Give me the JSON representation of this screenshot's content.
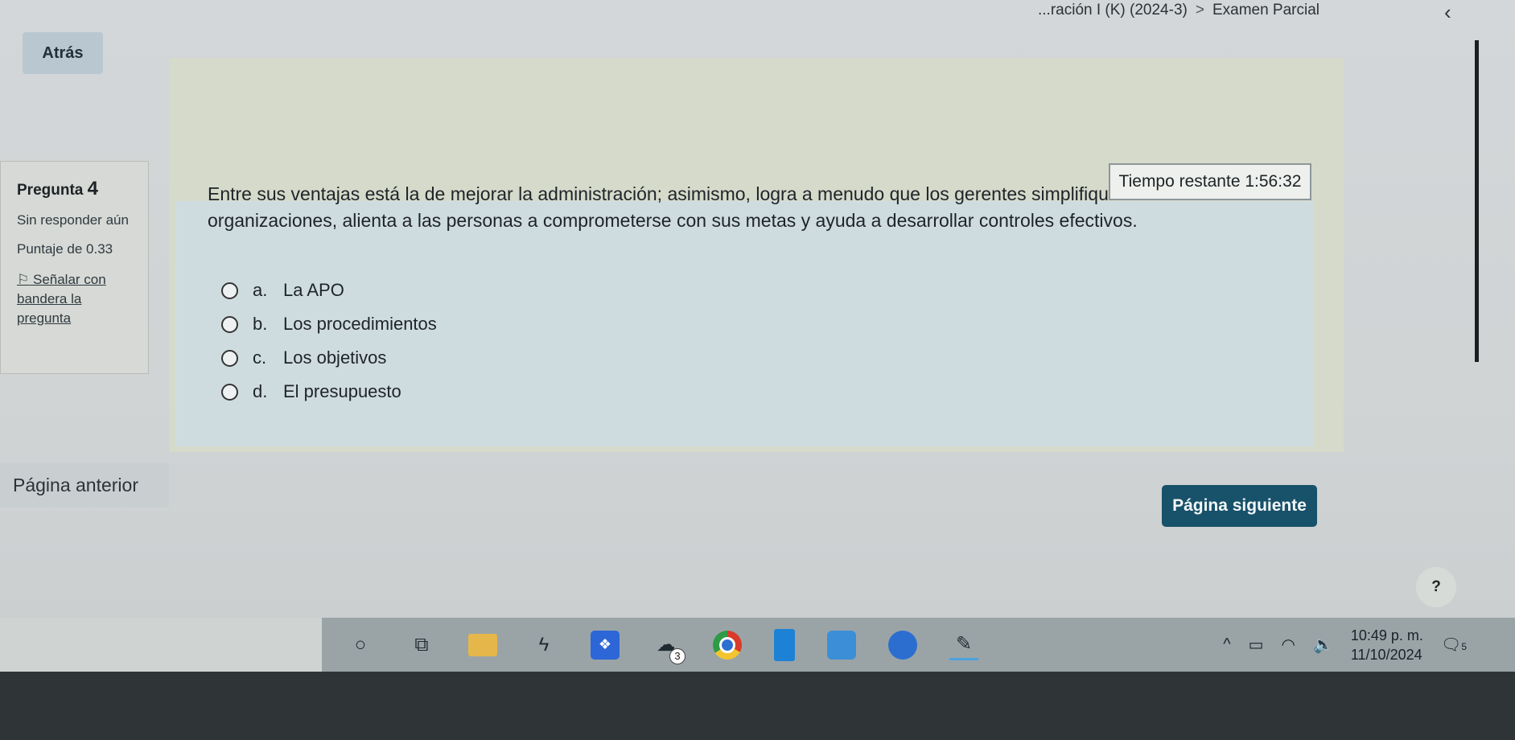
{
  "breadcrumb": {
    "prefix": "...ración I (K) (2024-3)",
    "separator": ">",
    "current": "Examen Parcial"
  },
  "nav": {
    "back_label": "Atrás",
    "top_arrow": "‹"
  },
  "question_info": {
    "title_prefix": "Pregunta",
    "number": "4",
    "status": "Sin responder aún",
    "score": "Puntaje de 0.33",
    "flag_label": "Señalar con bandera la pregunta"
  },
  "timer": {
    "label": "Tiempo restante",
    "value": "1:56:32"
  },
  "question": {
    "text": "Entre sus ventajas está la de mejorar la administración; asimismo, logra a menudo que los gerentes simplifiquen la estructura de sus organizaciones, alienta a las personas a comprometerse con sus metas y ayuda a desarrollar controles efectivos.",
    "options": [
      {
        "letter": "a.",
        "text": "La APO"
      },
      {
        "letter": "b.",
        "text": "Los procedimientos"
      },
      {
        "letter": "c.",
        "text": "Los objetivos"
      },
      {
        "letter": "d.",
        "text": "El presupuesto"
      }
    ]
  },
  "footer": {
    "prev_label": "Página anterior",
    "next_label": "Página siguiente",
    "help_label": "?"
  },
  "taskbar": {
    "icons": [
      "search-icon",
      "task-view-icon",
      "file-explorer-icon",
      "app-icon",
      "dropbox-icon",
      "app-badge-icon",
      "chrome-icon",
      "app-icon",
      "app-icon",
      "edge-icon",
      "app-icon"
    ],
    "badge_count": "3",
    "tray": {
      "chevron": "^",
      "time": "10:49 p. m.",
      "date": "11/10/2024",
      "notification_count": "5"
    }
  }
}
